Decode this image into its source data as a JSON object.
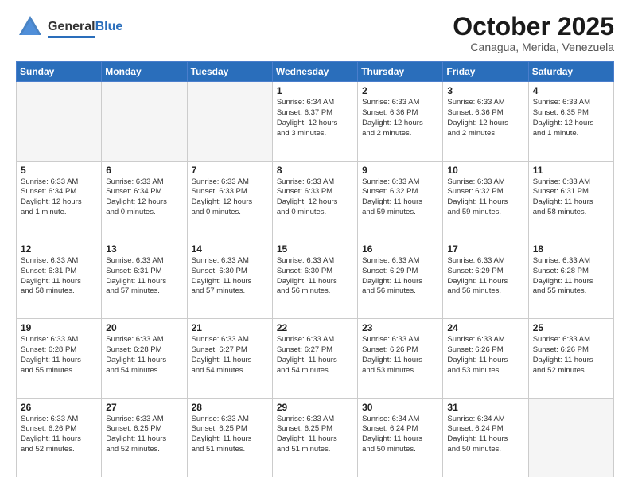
{
  "header": {
    "logo_general": "General",
    "logo_blue": "Blue",
    "month_title": "October 2025",
    "subtitle": "Canagua, Merida, Venezuela"
  },
  "weekdays": [
    "Sunday",
    "Monday",
    "Tuesday",
    "Wednesday",
    "Thursday",
    "Friday",
    "Saturday"
  ],
  "weeks": [
    [
      {
        "day": "",
        "info": "",
        "empty": true
      },
      {
        "day": "",
        "info": "",
        "empty": true
      },
      {
        "day": "",
        "info": "",
        "empty": true
      },
      {
        "day": "1",
        "info": "Sunrise: 6:34 AM\nSunset: 6:37 PM\nDaylight: 12 hours\nand 3 minutes."
      },
      {
        "day": "2",
        "info": "Sunrise: 6:33 AM\nSunset: 6:36 PM\nDaylight: 12 hours\nand 2 minutes."
      },
      {
        "day": "3",
        "info": "Sunrise: 6:33 AM\nSunset: 6:36 PM\nDaylight: 12 hours\nand 2 minutes."
      },
      {
        "day": "4",
        "info": "Sunrise: 6:33 AM\nSunset: 6:35 PM\nDaylight: 12 hours\nand 1 minute."
      }
    ],
    [
      {
        "day": "5",
        "info": "Sunrise: 6:33 AM\nSunset: 6:34 PM\nDaylight: 12 hours\nand 1 minute."
      },
      {
        "day": "6",
        "info": "Sunrise: 6:33 AM\nSunset: 6:34 PM\nDaylight: 12 hours\nand 0 minutes."
      },
      {
        "day": "7",
        "info": "Sunrise: 6:33 AM\nSunset: 6:33 PM\nDaylight: 12 hours\nand 0 minutes."
      },
      {
        "day": "8",
        "info": "Sunrise: 6:33 AM\nSunset: 6:33 PM\nDaylight: 12 hours\nand 0 minutes."
      },
      {
        "day": "9",
        "info": "Sunrise: 6:33 AM\nSunset: 6:32 PM\nDaylight: 11 hours\nand 59 minutes."
      },
      {
        "day": "10",
        "info": "Sunrise: 6:33 AM\nSunset: 6:32 PM\nDaylight: 11 hours\nand 59 minutes."
      },
      {
        "day": "11",
        "info": "Sunrise: 6:33 AM\nSunset: 6:31 PM\nDaylight: 11 hours\nand 58 minutes."
      }
    ],
    [
      {
        "day": "12",
        "info": "Sunrise: 6:33 AM\nSunset: 6:31 PM\nDaylight: 11 hours\nand 58 minutes."
      },
      {
        "day": "13",
        "info": "Sunrise: 6:33 AM\nSunset: 6:31 PM\nDaylight: 11 hours\nand 57 minutes."
      },
      {
        "day": "14",
        "info": "Sunrise: 6:33 AM\nSunset: 6:30 PM\nDaylight: 11 hours\nand 57 minutes."
      },
      {
        "day": "15",
        "info": "Sunrise: 6:33 AM\nSunset: 6:30 PM\nDaylight: 11 hours\nand 56 minutes."
      },
      {
        "day": "16",
        "info": "Sunrise: 6:33 AM\nSunset: 6:29 PM\nDaylight: 11 hours\nand 56 minutes."
      },
      {
        "day": "17",
        "info": "Sunrise: 6:33 AM\nSunset: 6:29 PM\nDaylight: 11 hours\nand 56 minutes."
      },
      {
        "day": "18",
        "info": "Sunrise: 6:33 AM\nSunset: 6:28 PM\nDaylight: 11 hours\nand 55 minutes."
      }
    ],
    [
      {
        "day": "19",
        "info": "Sunrise: 6:33 AM\nSunset: 6:28 PM\nDaylight: 11 hours\nand 55 minutes."
      },
      {
        "day": "20",
        "info": "Sunrise: 6:33 AM\nSunset: 6:28 PM\nDaylight: 11 hours\nand 54 minutes."
      },
      {
        "day": "21",
        "info": "Sunrise: 6:33 AM\nSunset: 6:27 PM\nDaylight: 11 hours\nand 54 minutes."
      },
      {
        "day": "22",
        "info": "Sunrise: 6:33 AM\nSunset: 6:27 PM\nDaylight: 11 hours\nand 54 minutes."
      },
      {
        "day": "23",
        "info": "Sunrise: 6:33 AM\nSunset: 6:26 PM\nDaylight: 11 hours\nand 53 minutes."
      },
      {
        "day": "24",
        "info": "Sunrise: 6:33 AM\nSunset: 6:26 PM\nDaylight: 11 hours\nand 53 minutes."
      },
      {
        "day": "25",
        "info": "Sunrise: 6:33 AM\nSunset: 6:26 PM\nDaylight: 11 hours\nand 52 minutes."
      }
    ],
    [
      {
        "day": "26",
        "info": "Sunrise: 6:33 AM\nSunset: 6:26 PM\nDaylight: 11 hours\nand 52 minutes."
      },
      {
        "day": "27",
        "info": "Sunrise: 6:33 AM\nSunset: 6:25 PM\nDaylight: 11 hours\nand 52 minutes."
      },
      {
        "day": "28",
        "info": "Sunrise: 6:33 AM\nSunset: 6:25 PM\nDaylight: 11 hours\nand 51 minutes."
      },
      {
        "day": "29",
        "info": "Sunrise: 6:33 AM\nSunset: 6:25 PM\nDaylight: 11 hours\nand 51 minutes."
      },
      {
        "day": "30",
        "info": "Sunrise: 6:34 AM\nSunset: 6:24 PM\nDaylight: 11 hours\nand 50 minutes."
      },
      {
        "day": "31",
        "info": "Sunrise: 6:34 AM\nSunset: 6:24 PM\nDaylight: 11 hours\nand 50 minutes."
      },
      {
        "day": "",
        "info": "",
        "empty": true
      }
    ]
  ]
}
